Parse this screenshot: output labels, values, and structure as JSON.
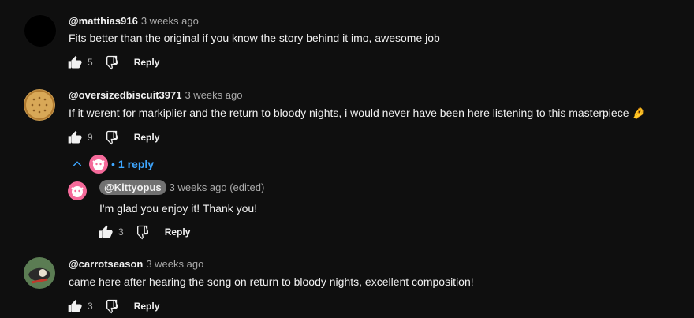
{
  "comments": [
    {
      "author": "@matthias916",
      "time": "3 weeks ago",
      "text": "Fits better than the original if you know the story behind it imo, awesome job",
      "likes": "5",
      "reply_label": "Reply"
    },
    {
      "author": "@oversizedbiscuit3971",
      "time": "3 weeks ago",
      "text": "If it werent for markiplier and the return to bloody nights, i would never have been here listening to this masterpiece 🤌",
      "likes": "9",
      "reply_label": "Reply",
      "replies_toggle": {
        "dot": "•",
        "label": "1 reply"
      },
      "reply": {
        "author": "@Kittyopus",
        "time": "3 weeks ago (edited)",
        "text": "I'm glad you enjoy it! Thank you!",
        "likes": "3",
        "reply_label": "Reply"
      }
    },
    {
      "author": "@carrotseason",
      "time": "3 weeks ago",
      "text": "came here after hearing the song on return to bloody nights, excellent composition!",
      "likes": "3",
      "reply_label": "Reply"
    }
  ],
  "colors": {
    "background": "#0f0f0f",
    "link_blue": "#3ea6ff",
    "creator_chip": "#717171",
    "avatar_pink": "#f56a9a"
  }
}
